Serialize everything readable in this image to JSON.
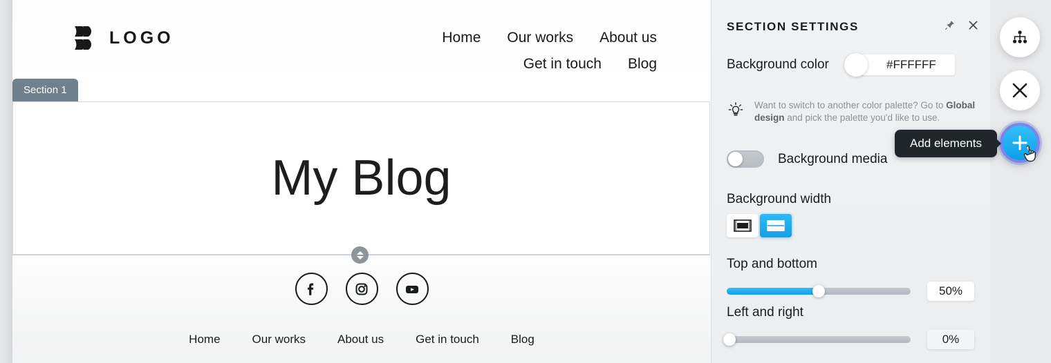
{
  "site": {
    "logo_text": "LOGO",
    "logo_icon": "double-chevron-logo-mark",
    "nav_row1": [
      {
        "label": "Home"
      },
      {
        "label": "Our works"
      },
      {
        "label": "About us"
      }
    ],
    "nav_row2": [
      {
        "label": "Get in touch"
      },
      {
        "label": "Blog"
      }
    ],
    "section_tab_label": "Section 1",
    "hero_title": "My Blog",
    "social": [
      {
        "name": "facebook-icon"
      },
      {
        "name": "instagram-icon"
      },
      {
        "name": "youtube-icon"
      }
    ],
    "footer_nav": [
      {
        "label": "Home"
      },
      {
        "label": "Our works"
      },
      {
        "label": "About us"
      },
      {
        "label": "Get in touch"
      },
      {
        "label": "Blog"
      }
    ]
  },
  "panel": {
    "title": "SECTION SETTINGS",
    "pin_icon": "pushpin-icon",
    "close_icon": "close-icon",
    "background_color": {
      "label": "Background color",
      "value": "#FFFFFF",
      "swatch_color": "#FFFFFF"
    },
    "hint": {
      "icon": "lightbulb-icon",
      "text_before": "Want to switch to another color palette? Go to ",
      "link_text": "Global design",
      "text_after": " and pick the palette you'd like to use."
    },
    "background_media": {
      "label": "Background media",
      "enabled": false
    },
    "background_width": {
      "label": "Background width",
      "options": [
        {
          "name": "boxed-width-icon",
          "selected": false
        },
        {
          "name": "full-width-icon",
          "selected": true
        }
      ]
    },
    "top_and_bottom": {
      "label": "Top and bottom",
      "value": "50%",
      "percent": 50
    },
    "left_and_right": {
      "label": "Left and right",
      "value": "0%",
      "percent": 0
    }
  },
  "rail": {
    "sitemap_icon": "sitemap-icon",
    "close_icon": "close-icon",
    "add_icon": "plus-icon",
    "cursor": "hand-pointer-cursor"
  },
  "tooltip": {
    "text": "Add elements"
  },
  "colors": {
    "accent_blue": "#12A3EA",
    "tab_gray": "#70808C",
    "tooltip_dark": "#21262D",
    "hint_gray": "#8D9196"
  }
}
